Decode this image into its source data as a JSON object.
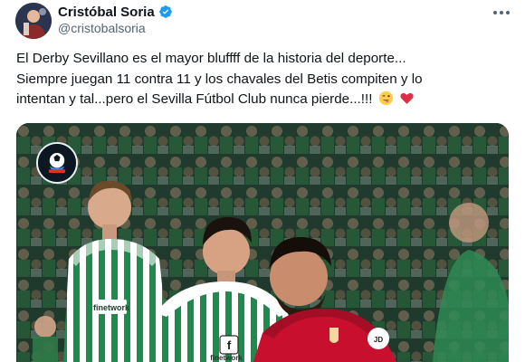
{
  "author": {
    "display_name": "Cristóbal Soria",
    "handle": "@cristobalsoria",
    "verified": true,
    "avatar_icon": "user-avatar"
  },
  "menu": {
    "icon": "more-options-icon"
  },
  "tweet": {
    "lines": [
      "El Derby Sevillano es el mayor bluffff de la historia del deporte...",
      "Siempre juegan 11 contra 11 y los chavales del Betis compiten y lo",
      "intentan y tal...pero el Sevilla Fútbol Club nunca pierde...!!!"
    ],
    "emojis": [
      "winking-face-with-tongue-emoji",
      "red-heart-emoji"
    ]
  },
  "media": {
    "description_icon": "football-photo",
    "jersey_text_1": "finetwork",
    "jersey_text_2": "finetwork",
    "colors": {
      "betis_green": "#1e8a4c",
      "sevilla_red": "#c8102e"
    }
  },
  "colors": {
    "verified_blue": "#1d9bf0",
    "secondary_text": "#536471",
    "primary_text": "#0f1419"
  }
}
